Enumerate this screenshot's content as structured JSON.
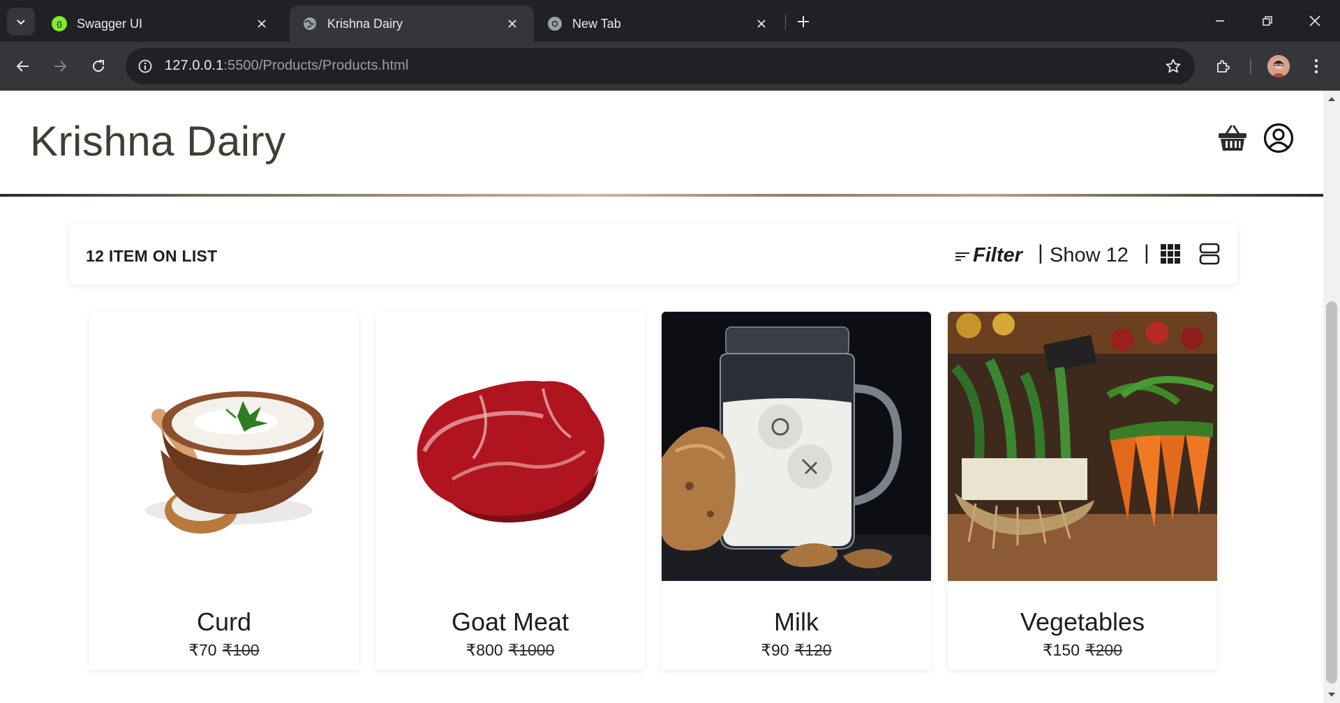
{
  "browser": {
    "tabs": [
      {
        "title": "Swagger UI",
        "favicon": "swagger-icon",
        "active": false
      },
      {
        "title": "Krishna Dairy",
        "favicon": "globe-icon",
        "active": true
      },
      {
        "title": "New Tab",
        "favicon": "chrome-icon",
        "active": false
      }
    ],
    "url_host": "127.0.0.1",
    "url_rest": ":5500/Products/Products.html"
  },
  "site": {
    "brand": "Krishna Dairy",
    "icons": [
      "basket-icon",
      "user-circle-icon"
    ]
  },
  "list_bar": {
    "count_label": "12 ITEM ON LIST",
    "filter_label": "Filter",
    "show_label": "Show 12",
    "separator": "|"
  },
  "products": [
    {
      "name": "Curd",
      "price": "₹70",
      "old_price": "₹100"
    },
    {
      "name": "Goat Meat",
      "price": "₹800",
      "old_price": "₹1000"
    },
    {
      "name": "Milk",
      "price": "₹90",
      "old_price": "₹120"
    },
    {
      "name": "Vegetables",
      "price": "₹150",
      "old_price": "₹200"
    }
  ],
  "colors": {
    "chrome_dark": "#202124",
    "chrome_mid": "#35363a",
    "brand_text": "#3a4034"
  }
}
